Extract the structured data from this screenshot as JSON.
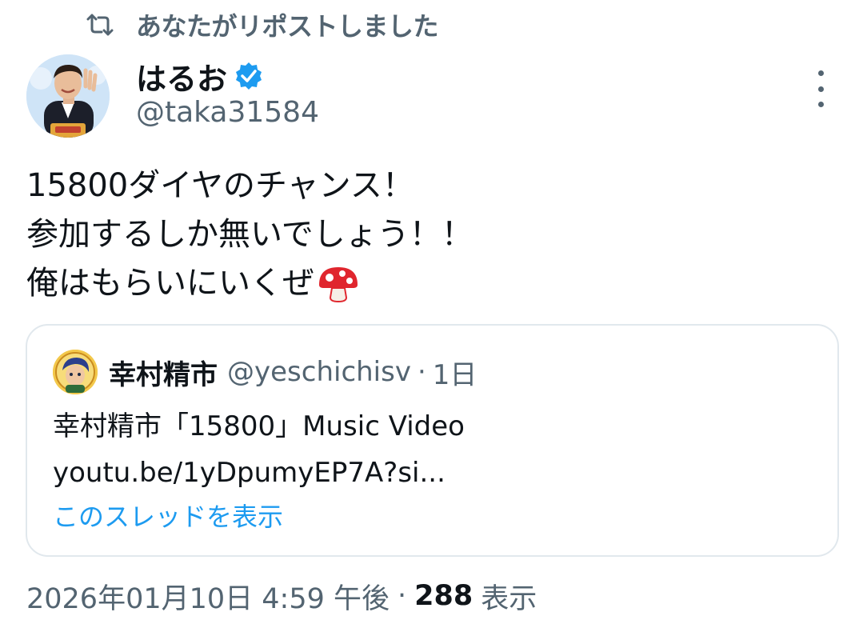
{
  "repost": {
    "icon": "repost-icon",
    "label": "あなたがリポストしました"
  },
  "tweet": {
    "author": {
      "name": "はるお",
      "handle": "@taka31584",
      "verified": true,
      "avatar_icon": "avatar"
    },
    "more_icon": "more-vertical-icon",
    "lines": [
      "15800ダイヤのチャンス！",
      "参加するしか無いでしょう！！",
      "俺はもらいにいくぜ"
    ],
    "emoji": "mushroom-icon",
    "quote": {
      "author_name": "幸村精市",
      "author_handle": "@yeschichisv",
      "separator": "·",
      "time": "1日",
      "body_lines": [
        "幸村精市「15800」Music Video",
        "youtu.be/1yDpumyEP7A?si..."
      ],
      "thread_link": "このスレッドを表示"
    },
    "meta": {
      "timestamp": "2026年01月10日 4:59 午後",
      "separator": "·",
      "views": "288",
      "views_label": "表示"
    }
  },
  "colors": {
    "primary_text": "#0f1419",
    "secondary_text": "#536471",
    "accent": "#1d9bf0",
    "border": "#e1e8ed"
  }
}
